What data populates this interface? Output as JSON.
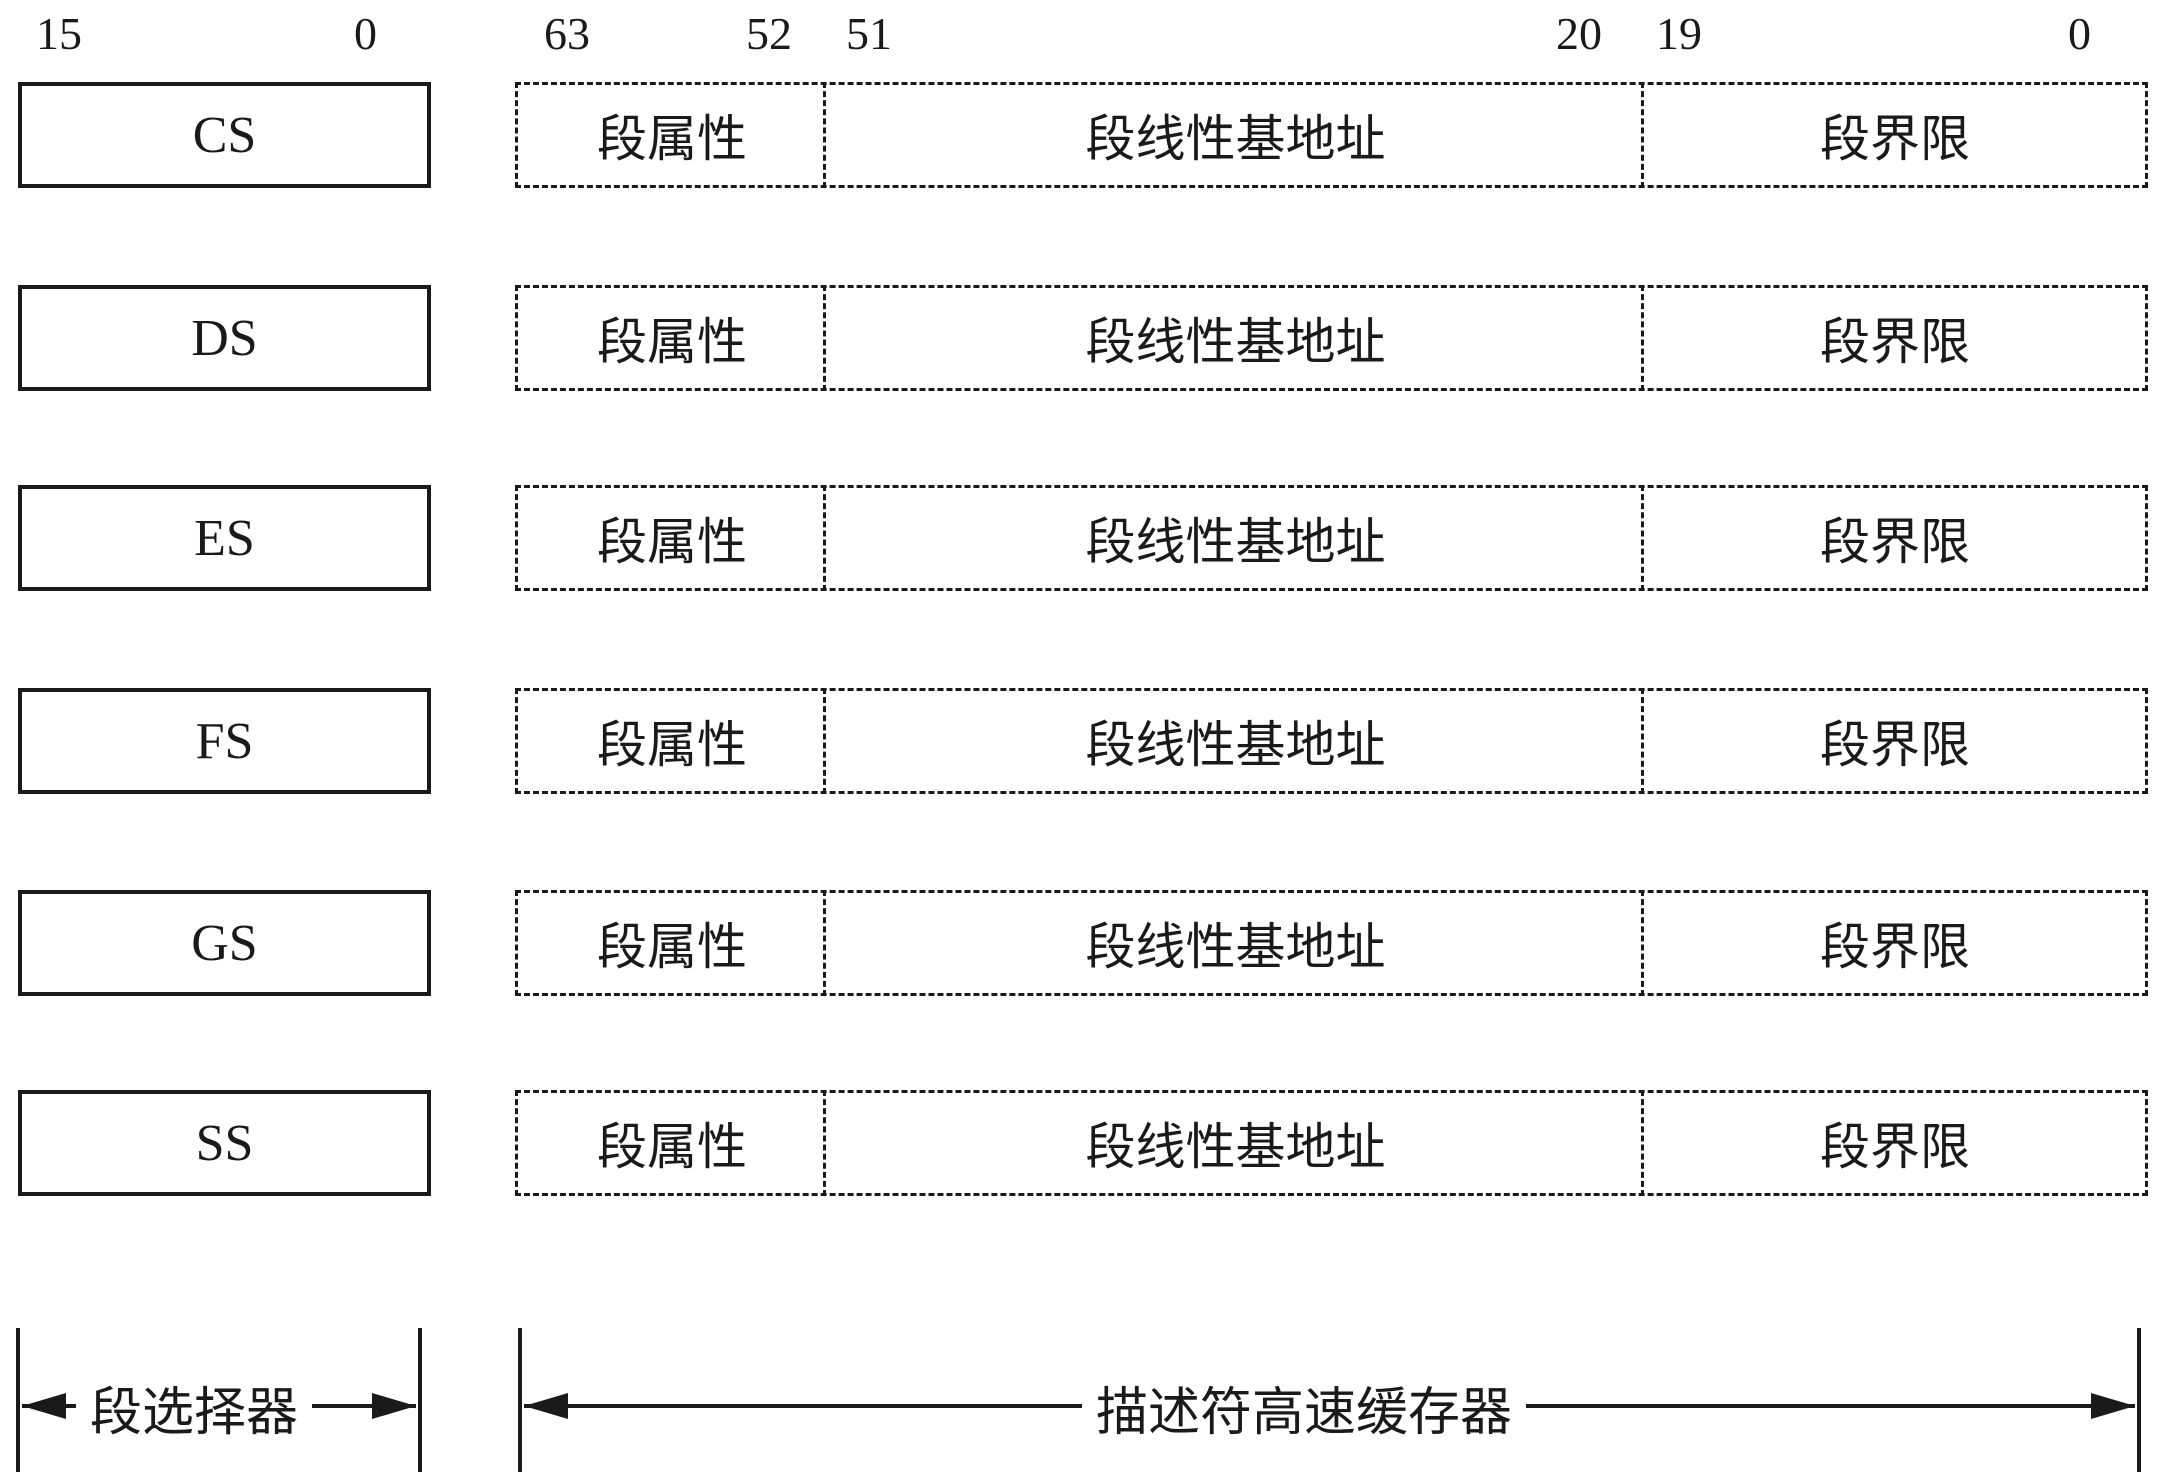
{
  "bit_labels": {
    "selector_high": "15",
    "selector_low": "0",
    "attr_high": "63",
    "attr_low": "52",
    "base_high": "51",
    "base_low": "20",
    "limit_high": "19",
    "limit_low": "0"
  },
  "registers": [
    {
      "name": "CS",
      "attr": "段属性",
      "base": "段线性基地址",
      "limit": "段界限"
    },
    {
      "name": "DS",
      "attr": "段属性",
      "base": "段线性基地址",
      "limit": "段界限"
    },
    {
      "name": "ES",
      "attr": "段属性",
      "base": "段线性基地址",
      "limit": "段界限"
    },
    {
      "name": "FS",
      "attr": "段属性",
      "base": "段线性基地址",
      "limit": "段界限"
    },
    {
      "name": "GS",
      "attr": "段属性",
      "base": "段线性基地址",
      "limit": "段界限"
    },
    {
      "name": "SS",
      "attr": "段属性",
      "base": "段线性基地址",
      "limit": "段界限"
    }
  ],
  "dimensions": {
    "selector_label": "段选择器",
    "cache_label": "描述符高速缓存器"
  }
}
